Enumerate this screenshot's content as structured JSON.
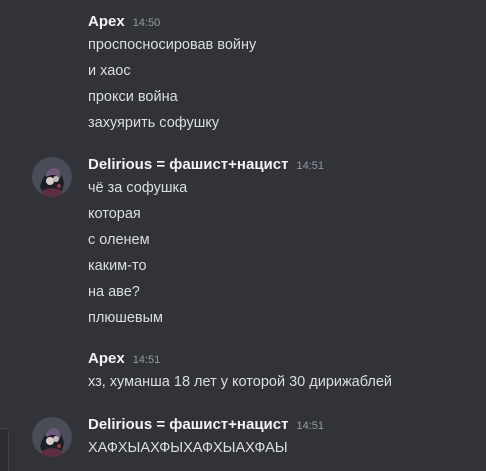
{
  "messages": [
    {
      "author": "Apex",
      "time": "14:50",
      "lines": [
        "проспосносировав войну",
        "и хаос",
        "прокси война",
        "захуярить софушку"
      ]
    },
    {
      "author": "Delirious = фашист+нацист",
      "time": "14:51",
      "lines": [
        "чё за софушка",
        "которая",
        "с оленем",
        "каким-то",
        "на аве?",
        "плюшевым"
      ]
    },
    {
      "author": "Apex",
      "time": "14:51",
      "lines": [
        "хз, хуманша 18 лет у которой 30 дирижаблей"
      ]
    },
    {
      "author": "Delirious = фашист+нацист",
      "time": "14:51",
      "lines": [
        "ХАФХЫАХФЫХАФХЫАХФАЫ"
      ]
    }
  ],
  "icons": {
    "avatar": "avatar-icon"
  },
  "colors": {
    "background": "#313338",
    "username": "#f2f3f5",
    "text": "#dbdee1",
    "timestamp": "#949ba4"
  }
}
